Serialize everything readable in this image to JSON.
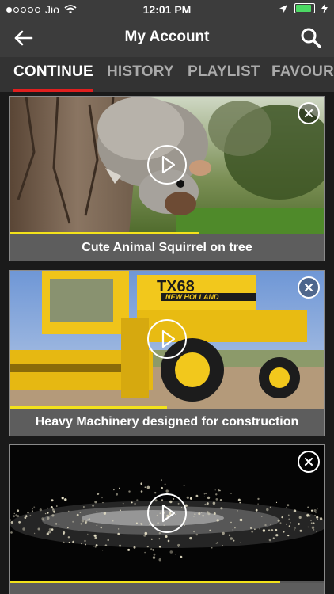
{
  "status_bar": {
    "carrier": "Jio",
    "time": "12:01 PM",
    "signal_icon": "signal-dots-icon",
    "wifi_icon": "wifi-icon",
    "location_icon": "location-arrow-icon",
    "battery_icon": "battery-icon",
    "charging_icon": "charging-bolt-icon",
    "battery_level": 0.9
  },
  "header": {
    "title": "My Account",
    "back_icon": "back-arrow-icon",
    "search_icon": "search-icon"
  },
  "tabs": [
    {
      "label": "CONTINUE",
      "active": true
    },
    {
      "label": "HISTORY",
      "active": false
    },
    {
      "label": "PLAYLIST",
      "active": false
    },
    {
      "label": "FAVOURITES",
      "active": false
    }
  ],
  "videos": [
    {
      "title": "Cute Animal Squirrel on tree",
      "progress": 0.6,
      "thumbnail": "squirrel-on-tree"
    },
    {
      "title": "Heavy Machinery designed for construction",
      "progress": 0.5,
      "thumbnail": "combine-harvester",
      "thumbnail_text_1": "TX68",
      "thumbnail_text_2": "NEW HOLLAND"
    },
    {
      "title": "",
      "progress": 0.86,
      "thumbnail": "sparks-in-dark"
    }
  ],
  "colors": {
    "accent_red": "#e01f1f",
    "progress_yellow": "#f3e21b",
    "bar_bg": "#3c3c3c",
    "caption_bg": "#5d5d5d"
  }
}
